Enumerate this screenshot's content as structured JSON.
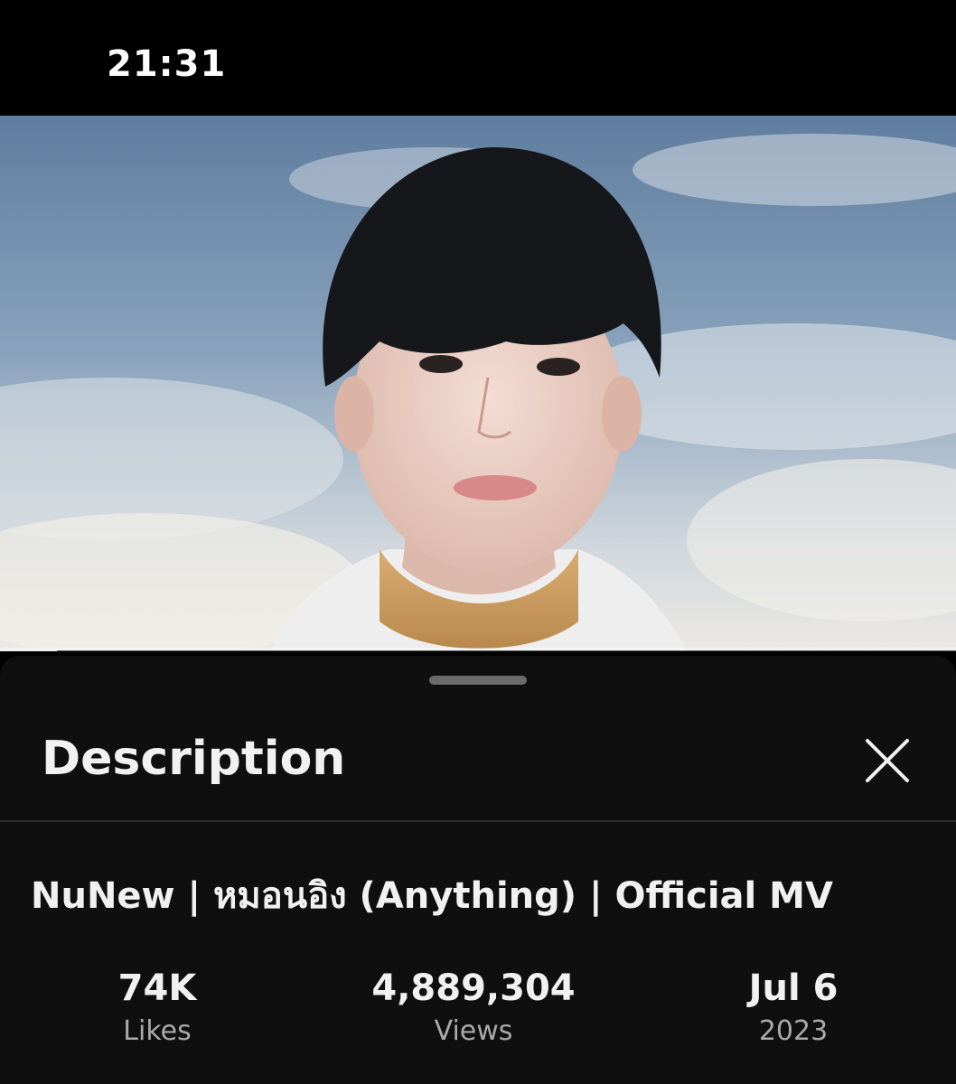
{
  "status_bar": {
    "time": "21:31"
  },
  "player": {
    "progress_fraction": 0.06
  },
  "description_panel": {
    "title": "Description",
    "close_icon": "close-icon",
    "video_title": "NuNew | หมอนอิง (Anything) | Official MV",
    "stats": {
      "likes": {
        "value": "74K",
        "label": "Likes"
      },
      "views": {
        "value": "4,889,304",
        "label": "Views"
      },
      "date": {
        "value": "Jul 6",
        "label": "2023"
      }
    }
  }
}
